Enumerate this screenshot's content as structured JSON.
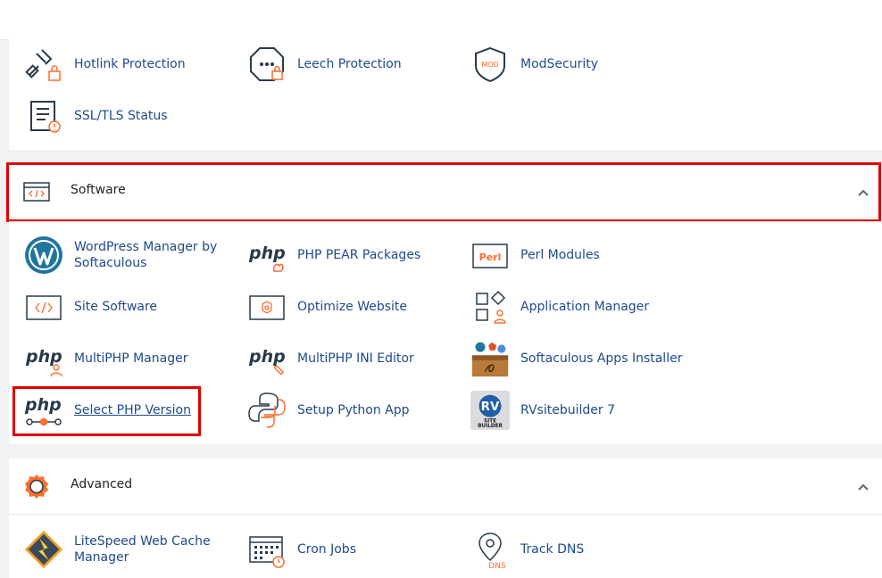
{
  "security": {
    "items": [
      {
        "label": "Hotlink Protection",
        "icon": "hotlink-icon"
      },
      {
        "label": "Leech Protection",
        "icon": "leech-icon"
      },
      {
        "label": "ModSecurity",
        "icon": "modsecurity-icon"
      },
      {
        "label": "SSL/TLS Status",
        "icon": "ssl-status-icon"
      }
    ],
    "mod_text": "MOD"
  },
  "software": {
    "title": "Software",
    "items": [
      {
        "label": "WordPress Manager by Softaculous",
        "icon": "wordpress-icon"
      },
      {
        "label": "PHP PEAR Packages",
        "icon": "php-pear-icon"
      },
      {
        "label": "Perl Modules",
        "icon": "perl-icon"
      },
      {
        "label": "Site Software",
        "icon": "site-software-icon"
      },
      {
        "label": "Optimize Website",
        "icon": "optimize-icon"
      },
      {
        "label": "Application Manager",
        "icon": "app-manager-icon"
      },
      {
        "label": "MultiPHP Manager",
        "icon": "multiphp-icon"
      },
      {
        "label": "MultiPHP INI Editor",
        "icon": "multiphp-ini-icon"
      },
      {
        "label": "Softaculous Apps Installer",
        "icon": "softaculous-icon"
      },
      {
        "label": "Select PHP Version",
        "icon": "select-php-icon"
      },
      {
        "label": "Setup Python App",
        "icon": "python-icon"
      },
      {
        "label": "RVsitebuilder 7",
        "icon": "rvsitebuilder-icon"
      }
    ],
    "php_text": "php",
    "perl_text": "Perl",
    "rv_text": "RV",
    "rv_sub1": "SITE",
    "rv_sub2": "BUILDER"
  },
  "advanced": {
    "title": "Advanced",
    "items": [
      {
        "label": "LiteSpeed Web Cache Manager",
        "icon": "litespeed-icon"
      },
      {
        "label": "Cron Jobs",
        "icon": "cron-icon"
      },
      {
        "label": "Track DNS",
        "icon": "track-dns-icon"
      }
    ],
    "dns_text": "DNS"
  },
  "colors": {
    "link": "#1f4a8c",
    "highlight": "#e00000",
    "accent": "#ff6c2c",
    "icon_dark": "#293a4a"
  }
}
